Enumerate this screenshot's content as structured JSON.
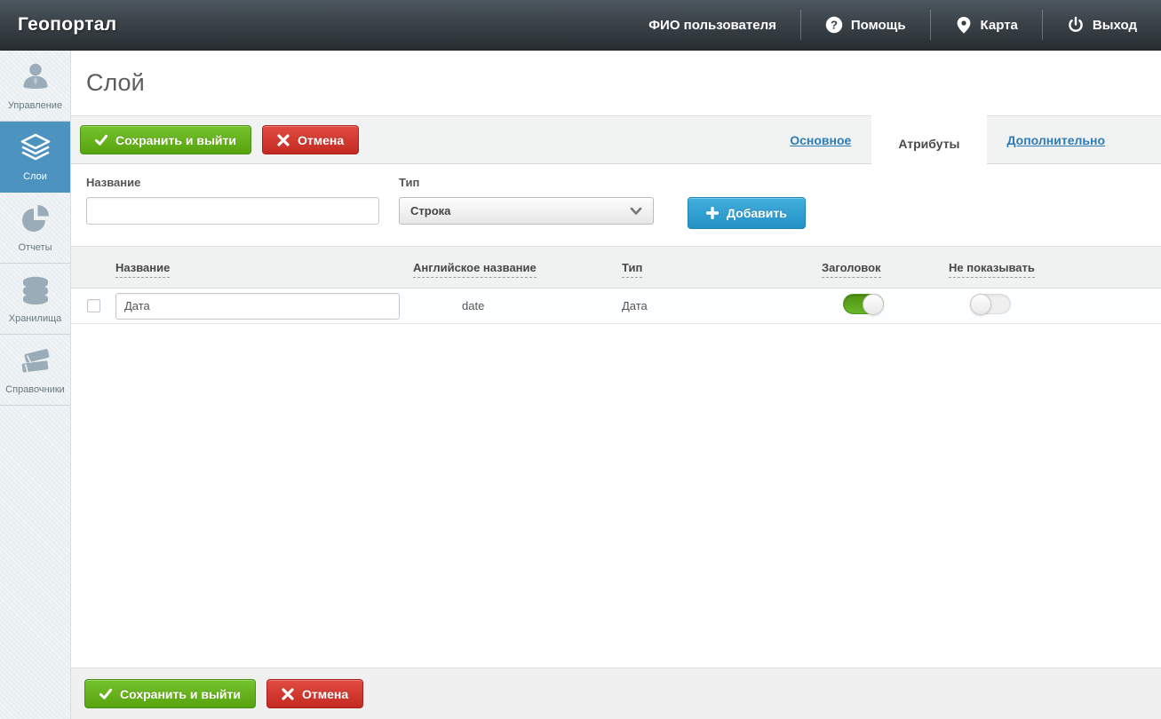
{
  "header": {
    "brand": "Геопортал",
    "user_name": "ФИО пользователя",
    "help_label": "Помощь",
    "map_label": "Карта",
    "logout_label": "Выход"
  },
  "icons": {
    "help_glyph": "?"
  },
  "sidebar": {
    "items": [
      {
        "label": "Управление",
        "icon": "user-icon",
        "active": false
      },
      {
        "label": "Слои",
        "icon": "layers-icon",
        "active": true
      },
      {
        "label": "Отчеты",
        "icon": "pie-chart-icon",
        "active": false
      },
      {
        "label": "Хранилища",
        "icon": "database-icon",
        "active": false
      },
      {
        "label": "Справочники",
        "icon": "books-icon",
        "active": false
      }
    ]
  },
  "page": {
    "title": "Слой"
  },
  "actions": {
    "save_label": "Сохранить и выйти",
    "cancel_label": "Отмена"
  },
  "tabs": [
    {
      "label": "Основное",
      "active": false
    },
    {
      "label": "Атрибуты",
      "active": true
    },
    {
      "label": "Дополнительно",
      "active": false
    }
  ],
  "form": {
    "name_label": "Название",
    "name_value": "",
    "name_placeholder": "",
    "type_label": "Тип",
    "type_value": "Строка",
    "add_label": "Добавить"
  },
  "table": {
    "columns": [
      "Название",
      "Английское название",
      "Тип",
      "Заголовок",
      "Не показывать"
    ],
    "rows": [
      {
        "name": "Дата",
        "english_name": "date",
        "type": "Дата",
        "header_enabled": true,
        "hidden_enabled": false,
        "selected": false
      }
    ]
  },
  "colors": {
    "sidebar_active_blue": "#4d93bf",
    "link_blue": "#2e7cb5",
    "success_green": "#5fae14",
    "danger_red": "#cf3a32",
    "info_blue": "#2f9fd4",
    "toggle_on_green": "#5ca21c",
    "header_dark": "#2b3237"
  }
}
